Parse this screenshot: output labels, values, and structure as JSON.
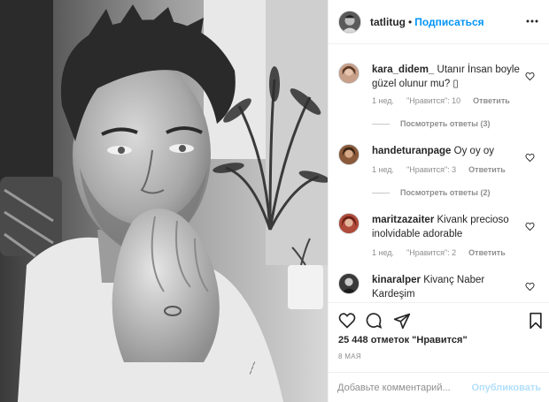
{
  "header": {
    "username": "tatlitug",
    "separator": "•",
    "follow_label": "Подписаться",
    "more_icon": "more-horizontal-icon"
  },
  "comments": [
    {
      "username": "kara_didem_",
      "text": "Utanır İnsan boyle güzel olunur mu? ▯",
      "time": "1 нед.",
      "likes": "\"Нравится\": 10",
      "reply": "Ответить",
      "view_replies": "Посмотреть ответы (3)"
    },
    {
      "username": "handeturanpage",
      "text": "Oy oy oy",
      "time": "1 нед.",
      "likes": "\"Нравится\": 3",
      "reply": "Ответить",
      "view_replies": "Посмотреть ответы (2)"
    },
    {
      "username": "maritzazaiter",
      "text": "Kivank precioso inolvidable adorable",
      "time": "1 нед.",
      "likes": "\"Нравится\": 2",
      "reply": "Ответить"
    },
    {
      "username": "kinaralper",
      "text": "Kivanç Naber Kardeşim"
    }
  ],
  "actions": {
    "like_icon": "heart-icon",
    "comment_icon": "comment-icon",
    "share_icon": "share-icon",
    "save_icon": "bookmark-icon"
  },
  "likes_text": "25 448 отметок \"Нравится\"",
  "date": "8 МАЯ",
  "add_comment": {
    "placeholder": "Добавьте комментарий...",
    "publish_label": "Опубликовать"
  },
  "colors": {
    "follow": "#0095f6",
    "publish_disabled": "#b2dffc",
    "muted": "#8e8e8e"
  }
}
